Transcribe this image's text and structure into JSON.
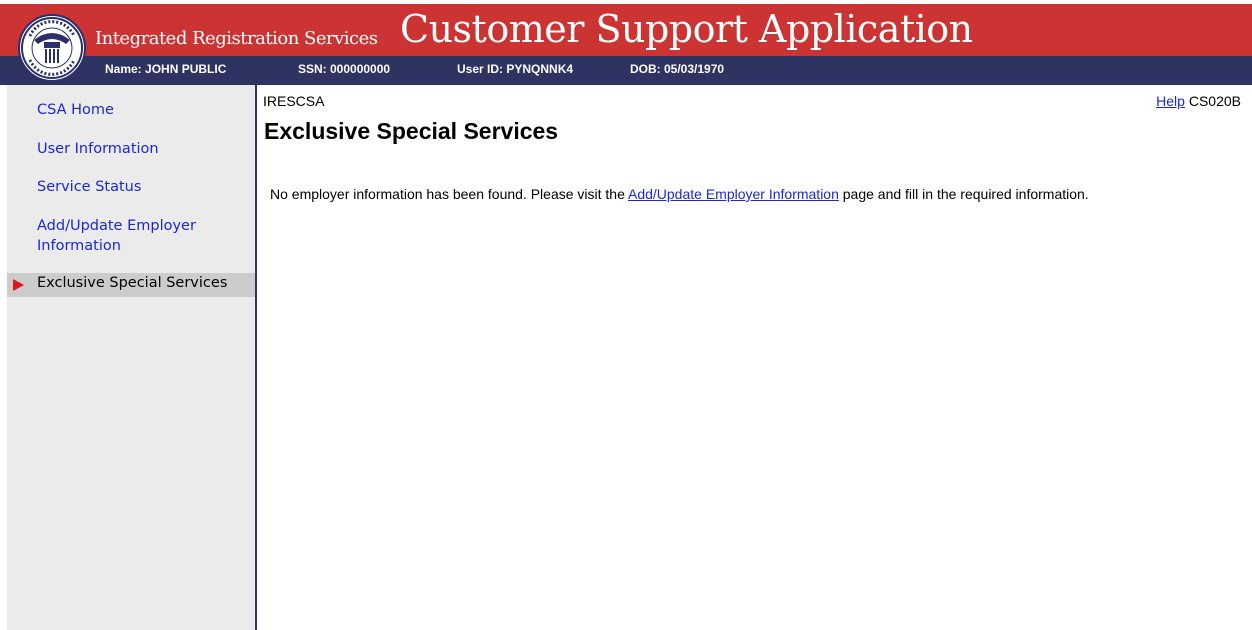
{
  "header": {
    "subtitle": "Integrated Registration Services",
    "title": "Customer Support Application",
    "seal_icon": "ssa-seal-icon",
    "seal_text": "SOCIAL SECURITY ADMINISTRATION USA",
    "colors": {
      "banner": "#cc3333",
      "infobar": "#2e3362"
    }
  },
  "infobar": {
    "name": "Name: JOHN PUBLIC",
    "ssn": "SSN: 000000000",
    "user_id": "User ID: PYNQNNK4",
    "dob": "DOB: 05/03/1970"
  },
  "sidebar": {
    "items": [
      {
        "label": "CSA Home"
      },
      {
        "label": "User Information"
      },
      {
        "label": "Service Status"
      },
      {
        "label": "Add/Update Employer"
      },
      {
        "label": "Information"
      }
    ],
    "active": {
      "label": "Exclusive Special Services",
      "icon": "red-arrow-icon"
    }
  },
  "main": {
    "app_code": "IRESCSA",
    "help_link": "Help",
    "screen_id": "CS020B",
    "title": "Exclusive Special Services",
    "message_before": "No employer information has been found. Please visit the ",
    "message_link": "Add/Update Employer Information",
    "message_after": " page and fill in the required information."
  }
}
